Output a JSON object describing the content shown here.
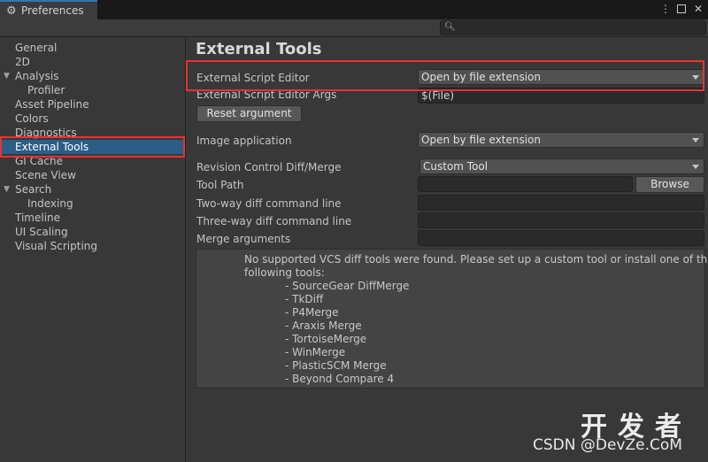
{
  "window": {
    "tab_title": "Preferences",
    "icons": {
      "tab": "gear-icon",
      "more": "more-vertical-icon",
      "maximize": "maximize-icon",
      "close": "close-icon"
    }
  },
  "search": {
    "placeholder": "",
    "icon": "search-icon"
  },
  "sidebar": {
    "items": [
      {
        "label": "General"
      },
      {
        "label": "2D"
      },
      {
        "label": "Analysis"
      },
      {
        "label": "Profiler"
      },
      {
        "label": "Asset Pipeline"
      },
      {
        "label": "Colors"
      },
      {
        "label": "Diagnostics"
      },
      {
        "label": "External Tools"
      },
      {
        "label": "GI Cache"
      },
      {
        "label": "Scene View"
      },
      {
        "label": "Search"
      },
      {
        "label": "Indexing"
      },
      {
        "label": "Timeline"
      },
      {
        "label": "UI Scaling"
      },
      {
        "label": "Visual Scripting"
      }
    ],
    "selected": "External Tools"
  },
  "main": {
    "title": "External Tools",
    "script_editor": {
      "label": "External Script Editor",
      "value": "Open by file extension"
    },
    "script_editor_args": {
      "label": "External Script Editor Args",
      "value": "$(File)"
    },
    "reset_button": "Reset argument",
    "image_app": {
      "label": "Image application",
      "value": "Open by file extension"
    },
    "revision_control": {
      "label": "Revision Control Diff/Merge",
      "value": "Custom Tool"
    },
    "tool_path": {
      "label": "Tool Path",
      "value": "",
      "browse_label": "Browse"
    },
    "two_way": {
      "label": "Two-way diff command line",
      "value": ""
    },
    "three_way": {
      "label": "Three-way diff command line",
      "value": ""
    },
    "merge_args": {
      "label": "Merge arguments",
      "value": ""
    },
    "help": {
      "line1": "No supported VCS diff tools were found. Please set up a custom tool or install one of the",
      "line2": "following tools:",
      "tools": [
        "- SourceGear DiffMerge",
        "- TkDiff",
        "- P4Merge",
        "- Araxis Merge",
        "- TortoiseMerge",
        "- WinMerge",
        "- PlasticSCM Merge",
        "- Beyond Compare 4"
      ]
    }
  },
  "watermark": {
    "cn": "开发者",
    "line": "CSDN @DevZe.CoM"
  },
  "colors": {
    "selection": "#2c5d87",
    "annotation": "#e53333",
    "background": "#383838"
  }
}
